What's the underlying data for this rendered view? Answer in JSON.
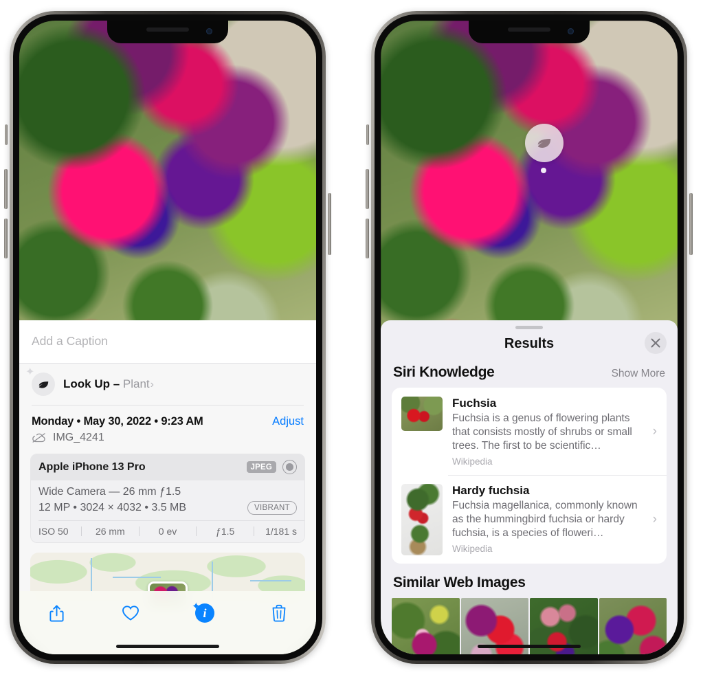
{
  "left_phone": {
    "caption": {
      "placeholder": "Add a Caption",
      "value": ""
    },
    "lookup": {
      "icon": "leaf-icon",
      "sparkle_icon": "sparkles-icon",
      "label": "Look Up – ",
      "subject": "Plant",
      "chevron": "›"
    },
    "date_row": {
      "date": "Monday • May 30, 2022 • 9:23 AM",
      "adjust_label": "Adjust"
    },
    "file_row": {
      "icon": "cloud-slash-icon",
      "filename": "IMG_4241"
    },
    "camera_card": {
      "model": "Apple iPhone 13 Pro",
      "format_badge": "JPEG",
      "hdr_icon": "hdr-ring-icon",
      "lens_line": "Wide Camera — 26 mm ƒ1.5",
      "size_line": "12 MP • 3024 × 4032 • 3.5 MB",
      "quality_pill": "VIBRANT",
      "exif": [
        "ISO 50",
        "26 mm",
        "0 ev",
        "ƒ1.5",
        "1/181 s"
      ]
    },
    "map": {
      "pin_icon": "photo-pin"
    },
    "toolbar": [
      {
        "name": "share-button",
        "icon": "share-icon"
      },
      {
        "name": "favorite-button",
        "icon": "heart-icon"
      },
      {
        "name": "info-button",
        "icon": "info-sparkle-icon",
        "glyph": "i"
      },
      {
        "name": "delete-button",
        "icon": "trash-icon"
      }
    ]
  },
  "right_phone": {
    "visual_lookup_badge": {
      "icon": "leaf-icon"
    },
    "sheet": {
      "title": "Results",
      "close_icon": "close-icon"
    },
    "siri_knowledge": {
      "section_title": "Siri Knowledge",
      "show_more": "Show More",
      "items": [
        {
          "title": "Fuchsia",
          "description": "Fuchsia is a genus of flowering plants that consists mostly of shrubs or small trees. The first to be scientific…",
          "source": "Wikipedia",
          "chevron": "›"
        },
        {
          "title": "Hardy fuchsia",
          "description": "Fuchsia magellanica, commonly known as the hummingbird fuchsia or hardy fuchsia, is a species of floweri…",
          "source": "Wikipedia",
          "chevron": "›"
        }
      ]
    },
    "similar_web_images": {
      "section_title": "Similar Web Images",
      "count": 4
    }
  },
  "colors": {
    "accent_blue": "#0a84ff",
    "link_blue": "#067cff",
    "sheet_bg": "#f0eff4",
    "info_bg": "#f7f7f7",
    "card_bg": "#ffffff",
    "muted_text": "#6e6d73"
  }
}
